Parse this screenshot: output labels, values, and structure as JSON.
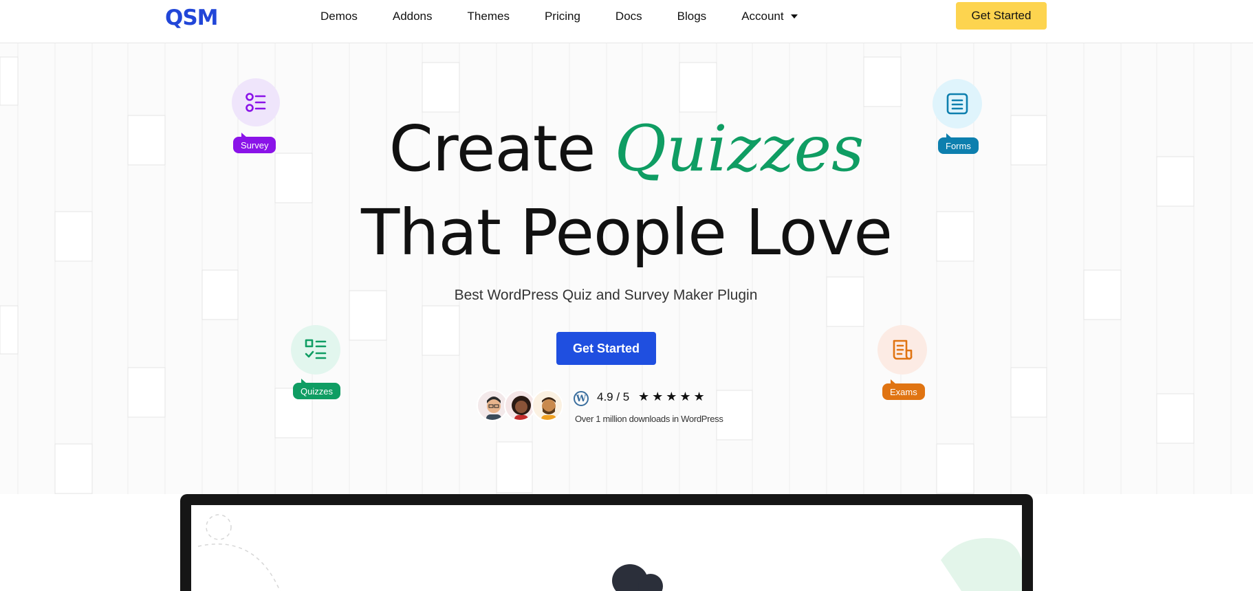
{
  "nav": {
    "logo": "QSM",
    "links": [
      "Demos",
      "Addons",
      "Themes",
      "Pricing",
      "Docs",
      "Blogs",
      "Account"
    ],
    "cta": "Get Started"
  },
  "hero": {
    "headline_part1": "Create ",
    "headline_accent": "Quizzes",
    "headline_line2": "That People Love",
    "subtitle": "Best WordPress Quiz and Survey Maker Plugin",
    "cta": "Get Started",
    "accent_color": "#0f9d63",
    "cta_color": "#1f4fe0"
  },
  "features": [
    {
      "label": "Survey",
      "icon": "survey-list-icon",
      "color": "#8a13e8"
    },
    {
      "label": "Forms",
      "icon": "form-document-icon",
      "color": "#0d7fae"
    },
    {
      "label": "Quizzes",
      "icon": "quiz-checklist-icon",
      "color": "#0f9d63"
    },
    {
      "label": "Exams",
      "icon": "exam-paper-icon",
      "color": "#e07412"
    }
  ],
  "rating": {
    "score": "4.9 / 5",
    "stars": "★★★★★",
    "downloads": "Over 1 million downloads in WordPress",
    "wp_icon_glyph": "W"
  }
}
